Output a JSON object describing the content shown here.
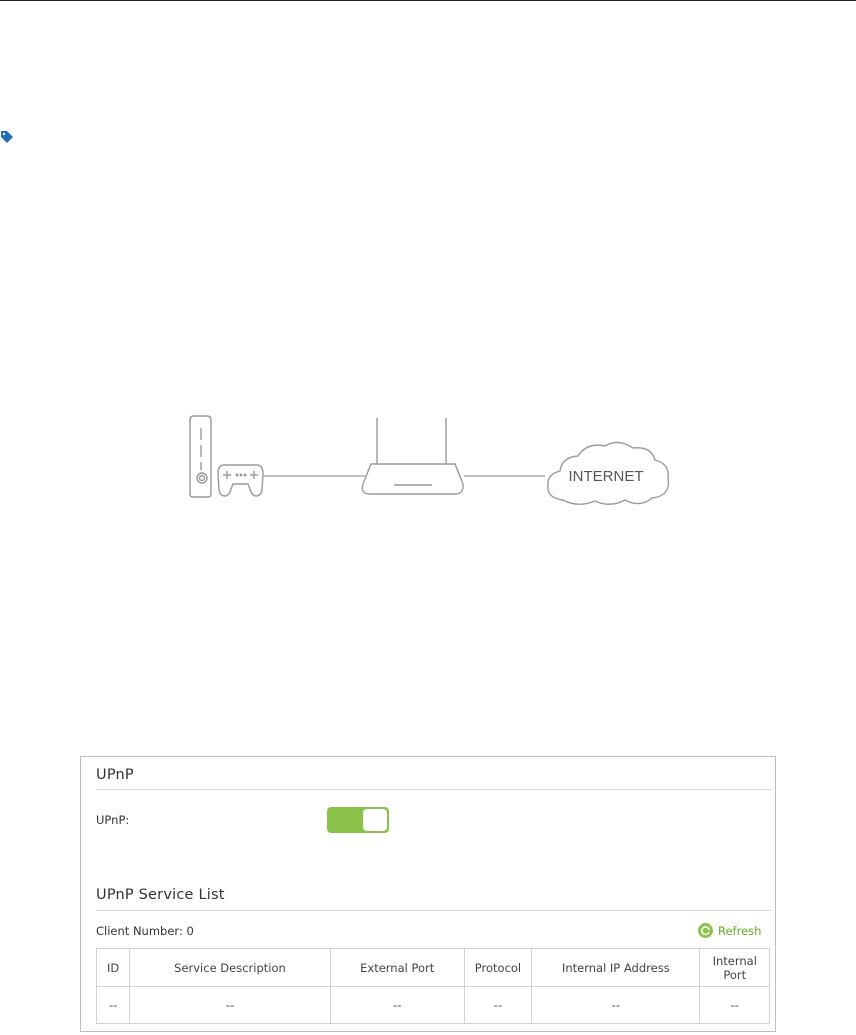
{
  "diagram": {
    "cloud_label": "INTERNET"
  },
  "upnp_panel": {
    "title": "UPnP",
    "upnp_label": "UPnP:",
    "upnp_toggle_state": "on",
    "service_list_title": "UPnP Service List",
    "client_number_label": "Client Number: 0",
    "refresh_label": "Refresh",
    "table": {
      "headers": [
        "ID",
        "Service Description",
        "External Port",
        "Protocol",
        "Internal IP Address",
        "Internal Port"
      ],
      "rows": [
        [
          "--",
          "--",
          "--",
          "--",
          "--",
          "--"
        ]
      ]
    }
  },
  "colors": {
    "accent_green": "#8bc34a",
    "refresh_green": "#6aa826",
    "tag_blue": "#1e6fb5"
  },
  "icons": [
    "tag-icon",
    "game-console-icon",
    "gamepad-icon",
    "router-icon",
    "internet-cloud-icon",
    "refresh-icon"
  ]
}
